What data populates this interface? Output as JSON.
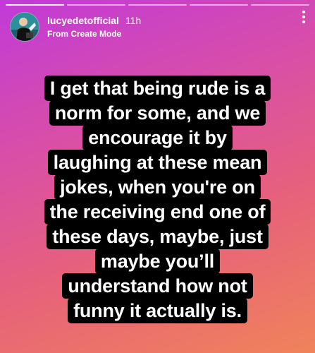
{
  "story": {
    "progress_count": 5,
    "current_index": 0
  },
  "header": {
    "username": "lucyedetofficial",
    "time": "11h",
    "subtitle": "From Create Mode",
    "avatar_icon": "profile-avatar-icon",
    "more_icon": "more-vertical-icon"
  },
  "caption": {
    "lines": [
      "I get that being rude is a",
      "norm for some, and we",
      "encourage it by",
      "laughing at these mean",
      "jokes, when you're on",
      "the receiving end one of",
      "these days, maybe, just",
      "maybe you’ll",
      "understand how not",
      "funny it actually is."
    ]
  },
  "colors": {
    "gradient_start": "#c13ad8",
    "gradient_end": "#f0835a",
    "text_background": "#000000",
    "text": "#ffffff"
  }
}
